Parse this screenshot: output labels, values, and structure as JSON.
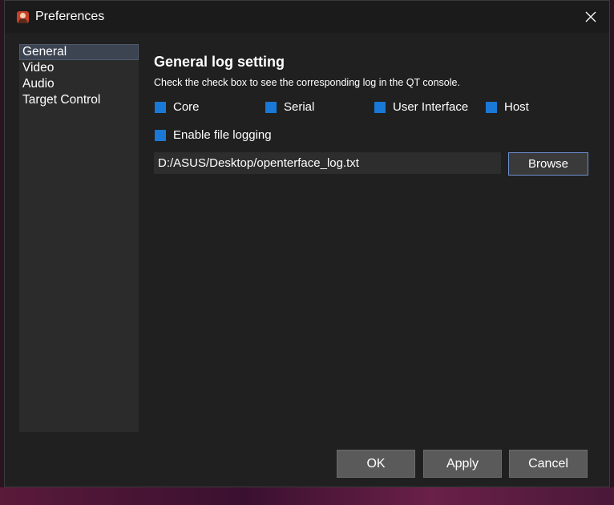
{
  "window": {
    "title": "Preferences"
  },
  "sidebar": {
    "items": [
      {
        "label": "General"
      },
      {
        "label": "Video"
      },
      {
        "label": "Audio"
      },
      {
        "label": "Target Control"
      }
    ]
  },
  "general": {
    "heading": "General log setting",
    "description": "Check the check box to see the corresponding log in the QT console.",
    "checkboxes": [
      {
        "label": "Core",
        "checked": true
      },
      {
        "label": "Serial",
        "checked": true
      },
      {
        "label": "User Interface",
        "checked": true
      },
      {
        "label": "Host",
        "checked": true
      }
    ],
    "file_logging": {
      "label": "Enable file logging",
      "checked": true
    },
    "log_path": "D:/ASUS/Desktop/openterface_log.txt",
    "browse_label": "Browse"
  },
  "footer": {
    "ok_label": "OK",
    "apply_label": "Apply",
    "cancel_label": "Cancel"
  },
  "colors": {
    "checkbox": "#1a78d6",
    "window_bg": "#202020",
    "sidebar_bg": "#2b2b2b"
  }
}
